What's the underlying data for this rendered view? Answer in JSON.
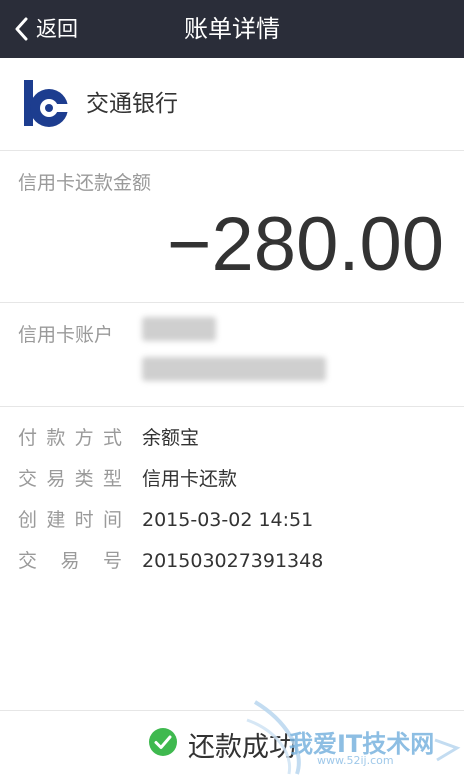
{
  "header": {
    "back_label": "返回",
    "title": "账单详情"
  },
  "bank": {
    "name": "交通银行",
    "logo_color": "#1d3d8f"
  },
  "amount": {
    "label": "信用卡还款金额",
    "value": "−280.00"
  },
  "account": {
    "label": "信用卡账户"
  },
  "details": [
    {
      "key": "付款方式",
      "value": "余额宝"
    },
    {
      "key": "交易类型",
      "value": "信用卡还款"
    },
    {
      "key": "创建时间",
      "value": "2015-03-02 14:51"
    },
    {
      "key": "交易号",
      "value": "201503027391348"
    }
  ],
  "footer": {
    "status_text": "还款成功",
    "status_color": "#3fb94f"
  },
  "watermark": {
    "text": "我爱IT技术网",
    "url": "www.52ij.com"
  }
}
